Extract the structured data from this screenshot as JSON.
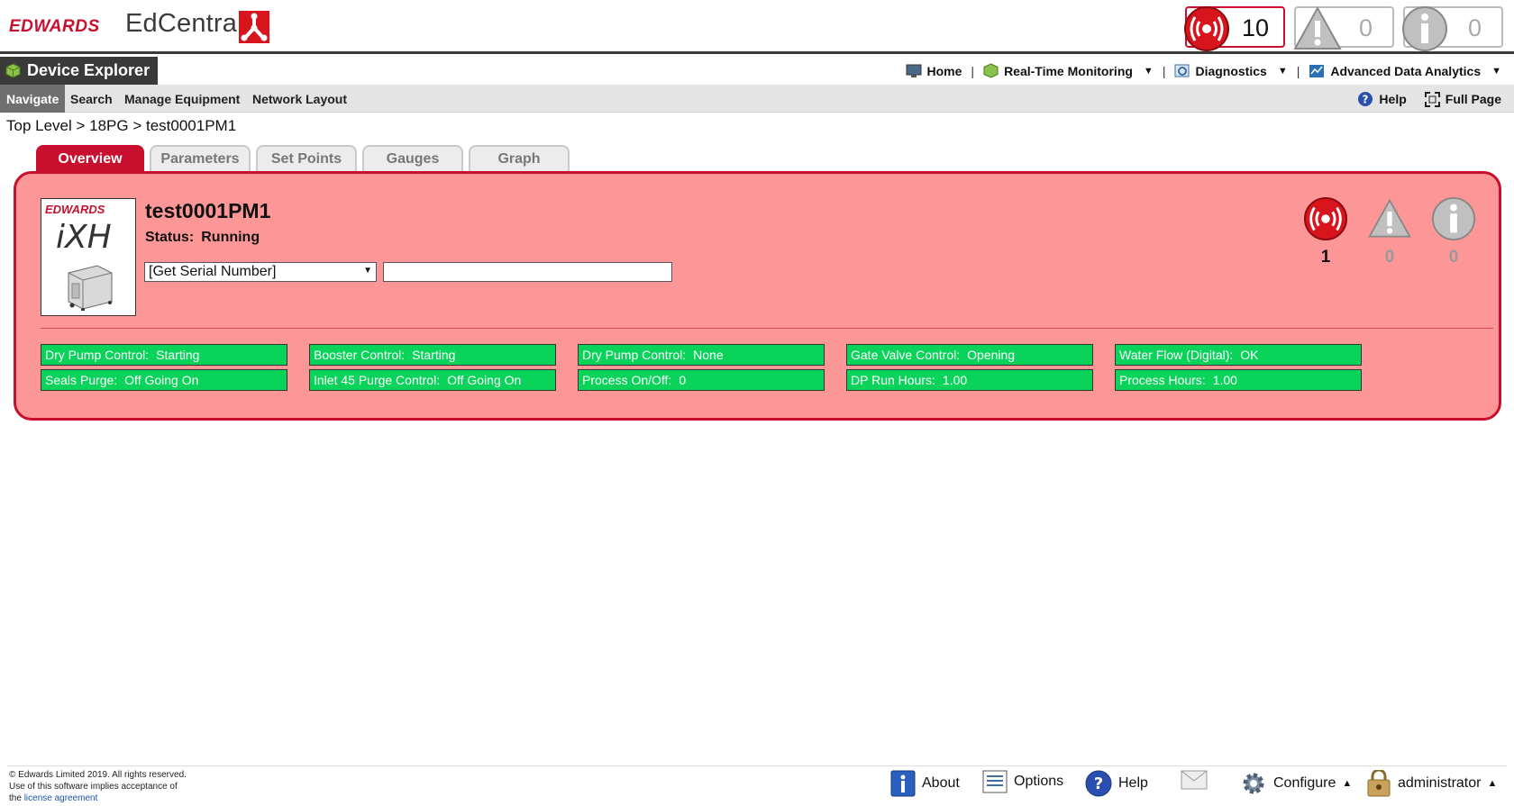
{
  "header": {
    "brand": "EDWARDS",
    "product": "EdCentra",
    "alarm_count": "10",
    "warning_count": "0",
    "info_count": "0",
    "colors": {
      "brand_red": "#c8102e",
      "panel_bg": "#fd9696",
      "status_green": "#0ad35a",
      "dark_bar": "#3a3a3a"
    }
  },
  "title_bar": {
    "title": "Device Explorer",
    "icon": "cube-icon",
    "nav": [
      {
        "label": "Home",
        "icon": "monitor-icon"
      },
      {
        "label": "Real-Time Monitoring",
        "icon": "cube-icon"
      },
      {
        "label": "Diagnostics",
        "icon": "diagnostics-icon"
      },
      {
        "label": "Advanced Data Analytics",
        "icon": "chart-icon"
      }
    ]
  },
  "subnav": {
    "items": [
      "Navigate",
      "Search",
      "Manage Equipment",
      "Network Layout"
    ],
    "help": "Help",
    "full_page": "Full Page"
  },
  "breadcrumb": "Top Level > 18PG > test0001PM1",
  "tabs": [
    "Overview",
    "Parameters",
    "Set Points",
    "Gauges",
    "Graph"
  ],
  "device": {
    "image_brand": "EDWARDS",
    "image_model": "iXH",
    "name": "test0001PM1",
    "status_label": "Status:",
    "status_value": "Running",
    "serial_select": "[Get Serial Number]",
    "serial_value": "",
    "alarm_count": "1",
    "warning_count": "0",
    "info_count": "0"
  },
  "status_cells": [
    [
      {
        "label": "Dry Pump Control:",
        "value": "Starting"
      },
      {
        "label": "Booster Control:",
        "value": "Starting"
      },
      {
        "label": "Dry Pump Control:",
        "value": "None"
      },
      {
        "label": "Gate Valve Control:",
        "value": "Opening"
      },
      {
        "label": "Water Flow (Digital):",
        "value": "OK"
      }
    ],
    [
      {
        "label": "Seals Purge:",
        "value": "Off Going On"
      },
      {
        "label": "Inlet 45 Purge Control:",
        "value": "Off Going On"
      },
      {
        "label": "Process On/Off:",
        "value": "0"
      },
      {
        "label": "DP Run Hours:",
        "value": "1.00"
      },
      {
        "label": "Process Hours:",
        "value": "1.00"
      }
    ]
  ],
  "footer": {
    "copyright_1": "© Edwards Limited 2019. All rights reserved.",
    "copyright_2": "Use of this software implies acceptance of",
    "copyright_3a": "the ",
    "copyright_3b": "license agreement",
    "about": "About",
    "options": "Options",
    "help": "Help",
    "configure": "Configure",
    "user": "administrator"
  }
}
